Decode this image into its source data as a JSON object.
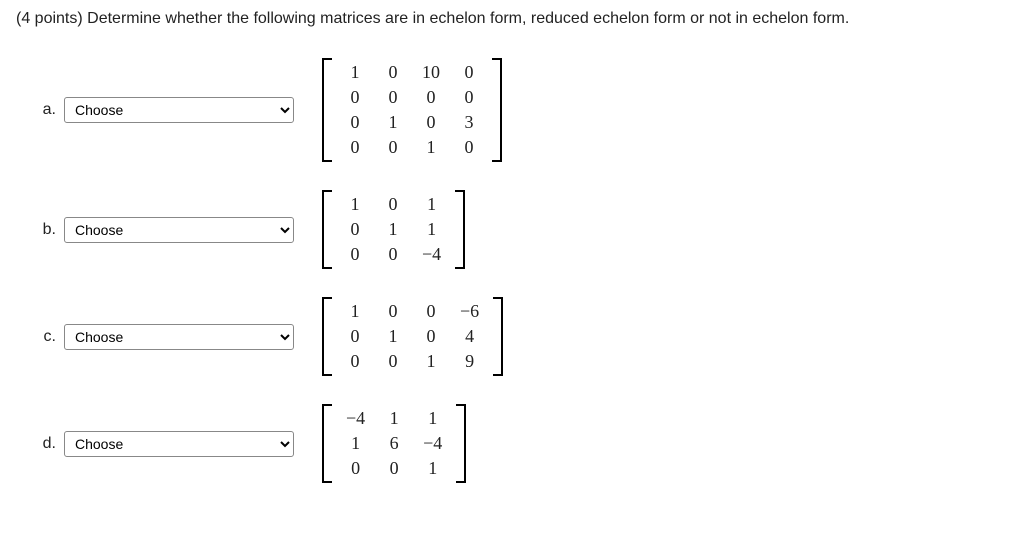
{
  "question": {
    "points_prefix": "(4 points) ",
    "text": "Determine whether the following matrices are in echelon form, reduced echelon form or not in echelon form."
  },
  "dropdown_placeholder": "Choose",
  "parts": [
    {
      "label": "a.",
      "matrix": [
        [
          "1",
          "0",
          "10",
          "0"
        ],
        [
          "0",
          "0",
          "0",
          "0"
        ],
        [
          "0",
          "1",
          "0",
          "3"
        ],
        [
          "0",
          "0",
          "1",
          "0"
        ]
      ]
    },
    {
      "label": "b.",
      "matrix": [
        [
          "1",
          "0",
          "1"
        ],
        [
          "0",
          "1",
          "1"
        ],
        [
          "0",
          "0",
          "−4"
        ]
      ]
    },
    {
      "label": "c.",
      "matrix": [
        [
          "1",
          "0",
          "0",
          "−6"
        ],
        [
          "0",
          "1",
          "0",
          "4"
        ],
        [
          "0",
          "0",
          "1",
          "9"
        ]
      ]
    },
    {
      "label": "d.",
      "matrix": [
        [
          "−4",
          "1",
          "1"
        ],
        [
          "1",
          "6",
          "−4"
        ],
        [
          "0",
          "0",
          "1"
        ]
      ]
    }
  ]
}
